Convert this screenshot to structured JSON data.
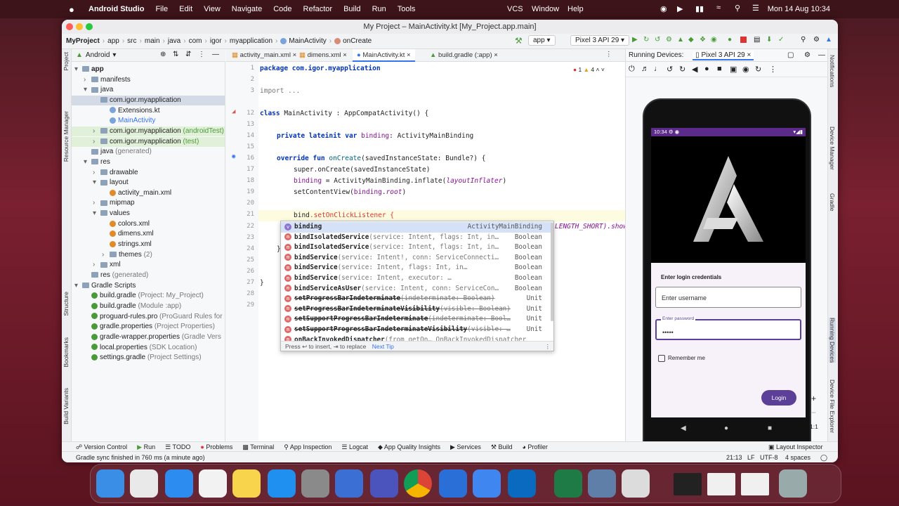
{
  "menubar": {
    "app": "Android Studio",
    "items": [
      "File",
      "Edit",
      "View",
      "Navigate",
      "Code",
      "Refactor",
      "Build",
      "Run",
      "Tools"
    ],
    "right_items": [
      "VCS",
      "Window",
      "Help"
    ],
    "clock": "Mon 14 Aug  10:34"
  },
  "window": {
    "title": "My Project – MainActivity.kt [My_Project.app.main]"
  },
  "toolbar": {
    "breadcrumbs": [
      "MyProject",
      "app",
      "src",
      "main",
      "java",
      "com",
      "igor",
      "myapplication",
      "MainActivity",
      "onCreate"
    ],
    "run_config": "app",
    "device": "Pixel 3 API 29"
  },
  "project_panel": {
    "view_selector": "Android",
    "strip_labels": [
      "Project",
      "Resource Manager",
      "Structure",
      "Bookmarks",
      "Build Variants"
    ],
    "tree": [
      {
        "label": "app",
        "depth": 0,
        "bold": true
      },
      {
        "label": "manifests",
        "depth": 1
      },
      {
        "label": "java",
        "depth": 1
      },
      {
        "label": "com.igor.myapplication",
        "depth": 2,
        "selected": true
      },
      {
        "label": "Extensions.kt",
        "depth": 3
      },
      {
        "label": "MainActivity",
        "depth": 3
      },
      {
        "label": "com.igor.myapplication",
        "suffix": "(androidTest)",
        "depth": 2
      },
      {
        "label": "com.igor.myapplication",
        "suffix": "(test)",
        "depth": 2
      },
      {
        "label": "java",
        "suffix": "(generated)",
        "depth": 1
      },
      {
        "label": "res",
        "depth": 1
      },
      {
        "label": "drawable",
        "depth": 2
      },
      {
        "label": "layout",
        "depth": 2
      },
      {
        "label": "activity_main.xml",
        "depth": 3
      },
      {
        "label": "mipmap",
        "depth": 2
      },
      {
        "label": "values",
        "depth": 2
      },
      {
        "label": "colors.xml",
        "depth": 3
      },
      {
        "label": "dimens.xml",
        "depth": 3
      },
      {
        "label": "strings.xml",
        "depth": 3
      },
      {
        "label": "themes",
        "suffix": "(2)",
        "depth": 3
      },
      {
        "label": "xml",
        "depth": 2
      },
      {
        "label": "res",
        "suffix": "(generated)",
        "depth": 1
      },
      {
        "label": "Gradle Scripts",
        "depth": 0
      },
      {
        "label": "build.gradle",
        "suffix": "(Project: My_Project)",
        "depth": 1
      },
      {
        "label": "build.gradle",
        "suffix": "(Module :app)",
        "depth": 1
      },
      {
        "label": "proguard-rules.pro",
        "suffix": "(ProGuard Rules for",
        "depth": 1
      },
      {
        "label": "gradle.properties",
        "suffix": "(Project Properties)",
        "depth": 1
      },
      {
        "label": "gradle-wrapper.properties",
        "suffix": "(Gradle Vers",
        "depth": 1
      },
      {
        "label": "local.properties",
        "suffix": "(SDK Location)",
        "depth": 1
      },
      {
        "label": "settings.gradle",
        "suffix": "(Project Settings)",
        "depth": 1
      }
    ]
  },
  "editor_tabs": [
    "activity_main.xml",
    "dimens.xml",
    "MainActivity.kt",
    "build.gradle (:app)"
  ],
  "inspections": {
    "errors": "1",
    "warnings": "4"
  },
  "code": {
    "line_numbers": [
      "1",
      "2",
      "3",
      "",
      "12",
      "13",
      "14",
      "15",
      "16",
      "17",
      "18",
      "19",
      "20",
      "21",
      "22",
      "23",
      "24",
      "25",
      "26",
      "27",
      "28",
      "29"
    ],
    "l1": "package com.igor.myapplication",
    "l3": "import ...",
    "l12a": "class ",
    "l12b": "MainActivity : AppCompatActivity() {",
    "l14a": "private lateinit var ",
    "l14b": "binding",
    "l14c": ": ActivityMainBinding",
    "l16a": "override fun ",
    "l16b": "onCreate",
    "l16c": "(savedInstanceState: Bundle?) {",
    "l17": "super.onCreate(savedInstanceState)",
    "l18a": "binding",
    "l18b": " = ActivityMainBinding.inflate(",
    "l18c": "layoutInflater",
    "l18d": ")",
    "l19a": "setContentView(",
    "l19b": "binding",
    "l19c": ".",
    "l19d": "root",
    "l19e": ")",
    "l21a": "bind",
    "l21b": ".setOnClickListener {",
    "l22tail": "LENGTH_SHORT).show",
    "l24": "}",
    "l26": "}"
  },
  "autocomplete": {
    "items": [
      {
        "name": "binding",
        "params": "",
        "type": "ActivityMainBinding",
        "kind": "v",
        "selected": true
      },
      {
        "name": "bindIsolatedService",
        "params": "(service: Intent, flags: Int, in…",
        "type": "Boolean",
        "kind": "m"
      },
      {
        "name": "bindIsolatedService",
        "params": "(service: Intent, flags: Int, in…",
        "type": "Boolean",
        "kind": "m"
      },
      {
        "name": "bindService",
        "params": "(service: Intent!, conn: ServiceConnecti…",
        "type": "Boolean",
        "kind": "m"
      },
      {
        "name": "bindService",
        "params": "(service: Intent, flags: Int, in…",
        "type": "Boolean",
        "kind": "m"
      },
      {
        "name": "bindService",
        "params": "(service: Intent, executor: …",
        "type": "Boolean",
        "kind": "m"
      },
      {
        "name": "bindServiceAsUser",
        "params": "(service: Intent, conn: ServiceCon…",
        "type": "Boolean",
        "kind": "m"
      },
      {
        "name": "setProgressBarIndeterminate",
        "params": "(indeterminate: Boolean)",
        "type": "Unit",
        "kind": "m",
        "deprecated": true
      },
      {
        "name": "setProgressBarIndeterminateVisibility",
        "params": "(visible: Boolean)",
        "type": "Unit",
        "kind": "m",
        "deprecated": true
      },
      {
        "name": "setSupportProgressBarIndeterminate",
        "params": "(indeterminate: Bool…",
        "type": "Unit",
        "kind": "m",
        "deprecated": true
      },
      {
        "name": "setSupportProgressBarIndeterminateVisibility",
        "params": "(visible: …",
        "type": "Unit",
        "kind": "m",
        "deprecated": true
      },
      {
        "name": "onBackInvokedDispatcher",
        "params": "(from getOn… OnBackInvokedDispatcher",
        "type": "",
        "kind": "m"
      }
    ],
    "footer_hint": "Press ↩ to insert, ⇥ to replace",
    "footer_link": "Next Tip"
  },
  "running_devices": {
    "label": "Running Devices:",
    "device_tab": "Pixel 3 API 29",
    "phone_time": "10:34",
    "login_heading": "Enter login credentials",
    "username_placeholder": "Enter username",
    "password_label": "Enter password",
    "password_value": "•••••",
    "remember_label": "Remember me",
    "login_button": "Login",
    "zoom_label": "1:1"
  },
  "right_strip_labels": [
    "Notifications",
    "Device Manager",
    "Gradle",
    "Running Devices",
    "Device File Explorer"
  ],
  "bottom_tools": [
    "Version Control",
    "Run",
    "TODO",
    "Problems",
    "Terminal",
    "App Inspection",
    "Logcat",
    "App Quality Insights",
    "Services",
    "Build",
    "Profiler",
    "Layout Inspector"
  ],
  "status": {
    "message": "Gradle sync finished in 760 ms (a minute ago)",
    "position": "21:13",
    "line_sep": "LF",
    "encoding": "UTF-8",
    "indent": "4 spaces"
  },
  "colors": {
    "accent": "#3574f0",
    "keyword": "#0033b3",
    "property": "#871094",
    "login_button": "#5b3f98"
  },
  "dock_icons": [
    "finder-icon",
    "launchpad-icon",
    "safari-icon",
    "reminders-icon",
    "notes-icon",
    "app-store-icon",
    "system-settings-icon",
    "android-studio-icon",
    "teams-icon",
    "chrome-icon",
    "xcode-icon",
    "xcode-beta-icon",
    "outlook-icon",
    "excel-icon",
    "quicktime-icon",
    "preview-icon",
    "android-logo-thumbnail-icon",
    "screenshot-thumbnail-icon",
    "screenshot-thumbnail-2-icon",
    "trash-icon"
  ]
}
